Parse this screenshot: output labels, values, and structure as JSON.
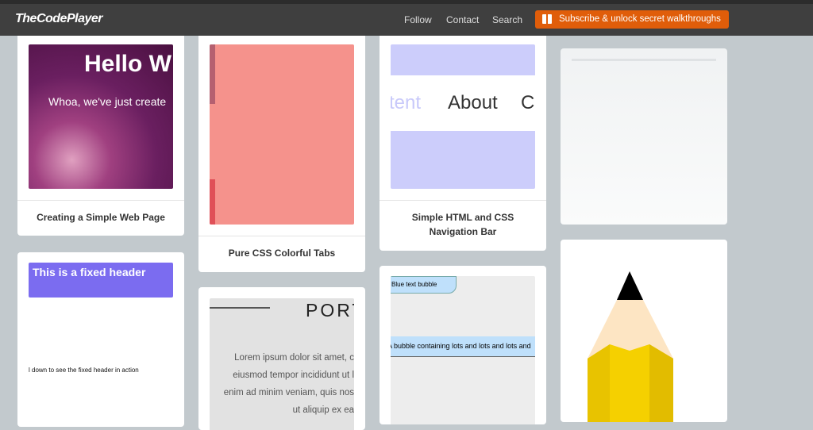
{
  "header": {
    "logo": "TheCodePlayer",
    "nav": [
      "Follow",
      "Contact",
      "Search"
    ],
    "subscribe": "Subscribe & unlock secret walkthroughs",
    "subscribe_icon": "gift-icon",
    "bg": "#3f3f3f",
    "accent": "#e05d0a"
  },
  "cards": [
    {
      "title": "Creating a Simple Web Page",
      "thumb_heading": "Hello W",
      "thumb_text": "Whoa, we've just create"
    },
    {
      "title": "Pure CSS Colorful Tabs"
    },
    {
      "title": "Simple HTML and CSS Navigation Bar",
      "thumb_left": "tent",
      "thumb_mid": "About",
      "thumb_right": "C"
    },
    {
      "title": ""
    },
    {
      "thumb_header": "This is a fixed header",
      "thumb_text": "l down to see the fixed header in action"
    },
    {
      "thumb_heading": "PORT",
      "thumb_lines": [
        "Lorem ipsum dolor sit amet, c",
        "eiusmod tempor incididunt ut l",
        "enim ad minim veniam, quis nos",
        "ut aliquip ex ea"
      ]
    },
    {
      "bubble1": "Blue text bubble",
      "bubble2": "A bubble containing lots and lots and lots and"
    },
    {
      "thumb_icon": "pencil-icon"
    }
  ]
}
